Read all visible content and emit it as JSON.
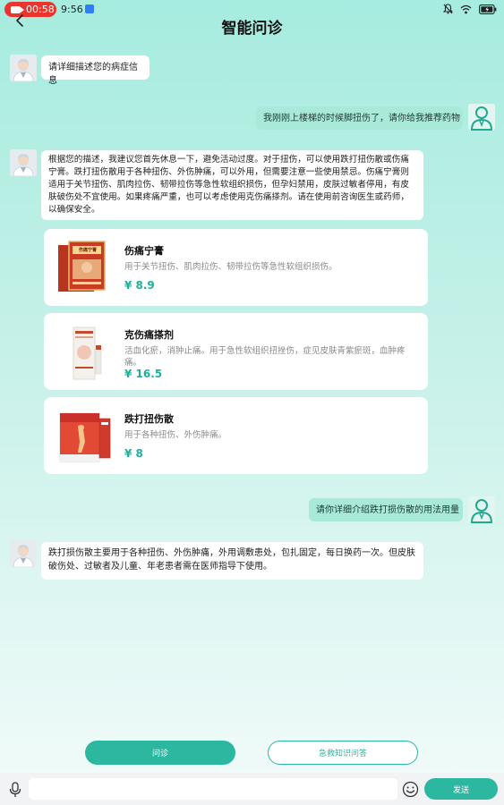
{
  "status_bar": {
    "record_time": "00:58",
    "clock": "9:56",
    "icons": [
      "mute-icon",
      "wifi-icon",
      "battery-icon"
    ]
  },
  "header": {
    "title": "智能问诊",
    "back_icon": "chevron-left-icon"
  },
  "messages": [
    {
      "role": "doctor",
      "text": "请详细描述您的病症信息"
    },
    {
      "role": "user",
      "text": "我刚刚上楼梯的时候脚扭伤了，请你给我推荐药物"
    },
    {
      "role": "doctor",
      "text": "根据您的描述，我建议您首先休息一下，避免活动过度。对于扭伤，可以使用跌打扭伤散或伤痛宁膏。跌打扭伤散用于各种扭伤、外伤肿痛，可以外用，但需要注意一些使用禁忌。伤痛宁膏则适用于关节扭伤、肌肉拉伤、韧带拉伤等急性软组织损伤，但孕妇禁用，皮肤过敏者停用，有皮肤破伤处不宜使用。如果疼痛严重，也可以考虑使用克伤痛搽剂。请在使用前咨询医生或药师，以确保安全。"
    },
    {
      "role": "user",
      "text": "请你详细介绍跌打损伤散的用法用量"
    },
    {
      "role": "doctor",
      "text": "跌打损伤散主要用于各种扭伤、外伤肿痛，外用调敷患处，包扎固定，每日换药一次。但皮肤破伤处、过敏者及儿童、年老患者需在医师指导下使用。"
    }
  ],
  "products": [
    {
      "name": "伤痛宁膏",
      "desc": "用于关节扭伤、肌肉拉伤、韧带拉伤等急性软组织损伤。",
      "price": "¥ 8.9",
      "box_label": "伤痛宁膏"
    },
    {
      "name": "克伤痛搽剂",
      "desc": "活血化瘀，消肿止痛。用于急性软组织扭挫伤，症见皮肤青紫瘀斑，血肿疼痛。",
      "price": "¥ 16.5"
    },
    {
      "name": "跌打扭伤散",
      "desc": "用于各种扭伤、外伤肿痛。",
      "price": "¥ 8"
    }
  ],
  "actions": {
    "consult_label": "问诊",
    "knowledge_label": "急救知识问答"
  },
  "input_bar": {
    "placeholder": "",
    "send_label": "发送"
  },
  "colors": {
    "accent": "#2bb7a0",
    "user_bubble": "#a9e9da",
    "price": "#1fb09a",
    "record": "#e8362f"
  }
}
